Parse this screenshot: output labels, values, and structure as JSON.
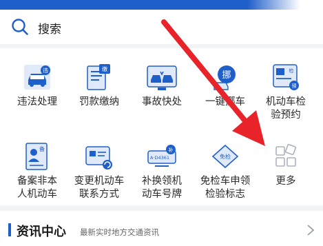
{
  "search": {
    "label": "搜索",
    "icon": "search-icon"
  },
  "services": [
    {
      "label": "违法处理",
      "icon": "violation-icon"
    },
    {
      "label": "罚款缴纳",
      "icon": "fine-payment-icon"
    },
    {
      "label": "事故快处",
      "icon": "accident-icon"
    },
    {
      "label": "一键挪车",
      "icon": "move-car-icon"
    },
    {
      "label": "机动车检\n验预约",
      "icon": "inspection-booking-icon"
    },
    {
      "label": "备案非本\n人机动车",
      "icon": "vehicle-filing-icon"
    },
    {
      "label": "变更机动车\n联系方式",
      "icon": "change-contact-icon"
    },
    {
      "label": "补换领机\n动车号牌",
      "icon": "license-plate-icon"
    },
    {
      "label": "免检车申领\n检验标志",
      "icon": "exempt-inspection-icon"
    },
    {
      "label": "更多",
      "icon": "more-grid-icon"
    }
  ],
  "icon_texts": {
    "violation": "违",
    "fine": "缴",
    "move": "挪",
    "inspection": "检",
    "booking": "预",
    "filing": "备",
    "plate_badge": "补",
    "plate_text": "A·D4361",
    "exempt": "免检"
  },
  "news": {
    "title": "资讯中心",
    "subtitle": "最新实时地方交通资讯"
  },
  "colors": {
    "accent": "#1f5fc9",
    "arrow": "#e8232a"
  }
}
